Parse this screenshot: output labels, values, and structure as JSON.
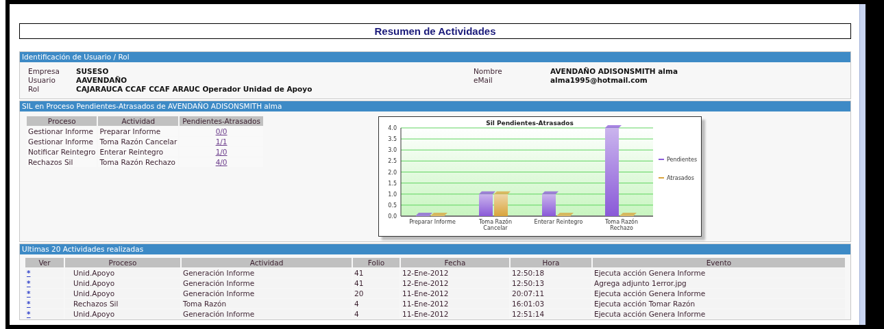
{
  "title": "Resumen de Actividades",
  "user_section": {
    "heading": "Identificación de Usuario / Rol",
    "left": [
      {
        "label": "Empresa",
        "value": "SUSESO"
      },
      {
        "label": "Usuario",
        "value": "AAVENDAÑO"
      },
      {
        "label": "Rol",
        "value": "CAJARAUCA CCAF CCAF ARAUC Operador Unidad de Apoyo"
      }
    ],
    "right": [
      {
        "label": "Nombre",
        "value": "AVENDAÑO ADISONSMITH alma"
      },
      {
        "label": "eMail",
        "value": "alma1995@hotmail.com"
      }
    ]
  },
  "sil_section": {
    "heading": "SIL en Proceso Pendientes-Atrasados de AVENDAÑO ADISONSMITH alma",
    "columns": [
      "Proceso",
      "Actividad",
      "Pendientes-Atrasados"
    ],
    "rows": [
      {
        "proceso": "Gestionar Informe",
        "actividad": "Preparar Informe",
        "count": "0/0"
      },
      {
        "proceso": "Gestionar Informe",
        "actividad": "Toma Razón Cancelar",
        "count": "1/1"
      },
      {
        "proceso": "Notificar Reintegro",
        "actividad": "Enterar Reintegro",
        "count": "1/0"
      },
      {
        "proceso": "Rechazos Sil",
        "actividad": "Toma Razón Rechazo",
        "count": "4/0"
      }
    ],
    "chart_data": {
      "type": "bar",
      "title": "Sil Pendientes-Atrasados",
      "categories": [
        "Preparar Informe",
        "Toma Razón Cancelar",
        "Enterar Reintegro",
        "Toma Razón Rechazo"
      ],
      "series": [
        {
          "name": "Pendientes",
          "color": "#8a5ad8",
          "values": [
            0,
            1,
            1,
            4
          ]
        },
        {
          "name": "Atrasados",
          "color": "#d9a43c",
          "values": [
            0,
            1,
            0,
            0
          ]
        }
      ],
      "grid": true,
      "legend": true,
      "ylim": [
        0,
        4
      ],
      "yticks": [
        {
          "value": 0,
          "label": "0.0"
        },
        {
          "value": 0.5,
          "label": "0.5"
        },
        {
          "value": 1,
          "label": "1.0"
        },
        {
          "value": 1.5,
          "label": "1.5"
        },
        {
          "value": 2,
          "label": "2.0"
        },
        {
          "value": 2.5,
          "label": "2.5"
        },
        {
          "value": 3,
          "label": "3.0"
        },
        {
          "value": 3.5,
          "label": "3.5"
        },
        {
          "value": 4,
          "label": "4.0"
        }
      ]
    }
  },
  "activity_section": {
    "heading": "Ultimas 20 Actividades realizadas",
    "columns": [
      "Ver",
      "Proceso",
      "Actividad",
      "Folio",
      "Fecha",
      "Hora",
      "Evento"
    ],
    "rows": [
      {
        "ver": "*",
        "proceso": "Unid.Apoyo",
        "actividad": "Generación Informe",
        "folio": "41",
        "fecha": "12-Ene-2012",
        "hora": "12:50:18",
        "evento": "Ejecuta acción Genera Informe"
      },
      {
        "ver": "*",
        "proceso": "Unid.Apoyo",
        "actividad": "Generación Informe",
        "folio": "41",
        "fecha": "12-Ene-2012",
        "hora": "12:50:13",
        "evento": "Agrega adjunto 1error.jpg"
      },
      {
        "ver": "*",
        "proceso": "Unid.Apoyo",
        "actividad": "Generación Informe",
        "folio": "20",
        "fecha": "11-Ene-2012",
        "hora": "20:07:11",
        "evento": "Ejecuta acción Genera Informe"
      },
      {
        "ver": "*",
        "proceso": "Rechazos Sil",
        "actividad": "Toma Razón",
        "folio": "4",
        "fecha": "11-Ene-2012",
        "hora": "16:01:03",
        "evento": "Ejecuta acción Tomar Razón"
      },
      {
        "ver": "*",
        "proceso": "Unid.Apoyo",
        "actividad": "Generación Informe",
        "folio": "4",
        "fecha": "11-Ene-2012",
        "hora": "12:51:14",
        "evento": "Ejecuta acción Genera Informe"
      }
    ]
  }
}
